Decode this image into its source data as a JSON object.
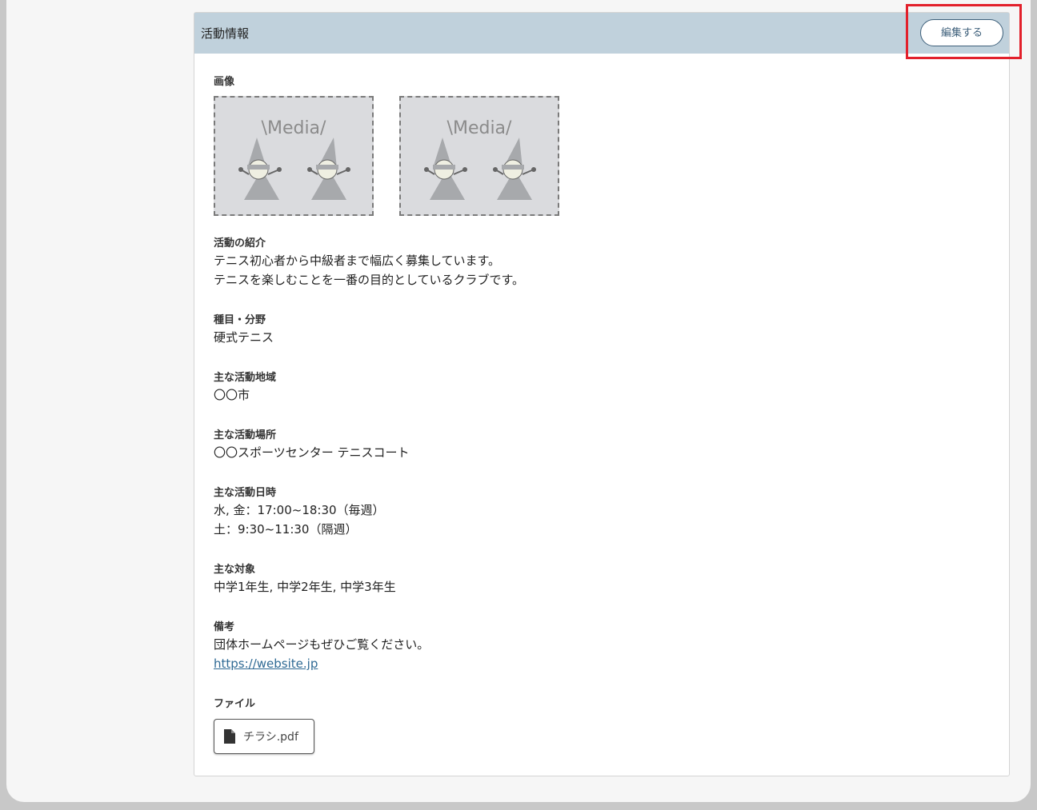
{
  "section_title": "活動情報",
  "edit_button": "編集する",
  "images": {
    "label": "画像",
    "items": [
      {
        "caption": "\\Media/"
      },
      {
        "caption": "\\Media/"
      }
    ]
  },
  "fields": {
    "intro": {
      "label": "活動の紹介",
      "lines": [
        "テニス初心者から中級者まで幅広く募集しています。",
        "テニスを楽しむことを一番の目的としているクラブです。"
      ]
    },
    "category": {
      "label": "種目・分野",
      "value": "硬式テニス"
    },
    "area": {
      "label": "主な活動地域",
      "value": "〇〇市"
    },
    "place": {
      "label": "主な活動場所",
      "value": "〇〇スポーツセンター テニスコート"
    },
    "schedule": {
      "label": "主な活動日時",
      "lines": [
        "水, 金：17:00~18:30（毎週）",
        "土：9:30~11:30（隔週）"
      ]
    },
    "target": {
      "label": "主な対象",
      "value": "中学1年生, 中学2年生, 中学3年生"
    },
    "notes": {
      "label": "備考",
      "value": "団体ホームページもぜひご覧ください。",
      "link": "https://website.jp"
    },
    "file": {
      "label": "ファイル",
      "name": "チラシ.pdf",
      "icon": "document-icon"
    }
  },
  "colors": {
    "header_bg": "#c0d1dc",
    "accent": "#3d5f7a",
    "link": "#2f6a94",
    "highlight": "#e2202b"
  }
}
